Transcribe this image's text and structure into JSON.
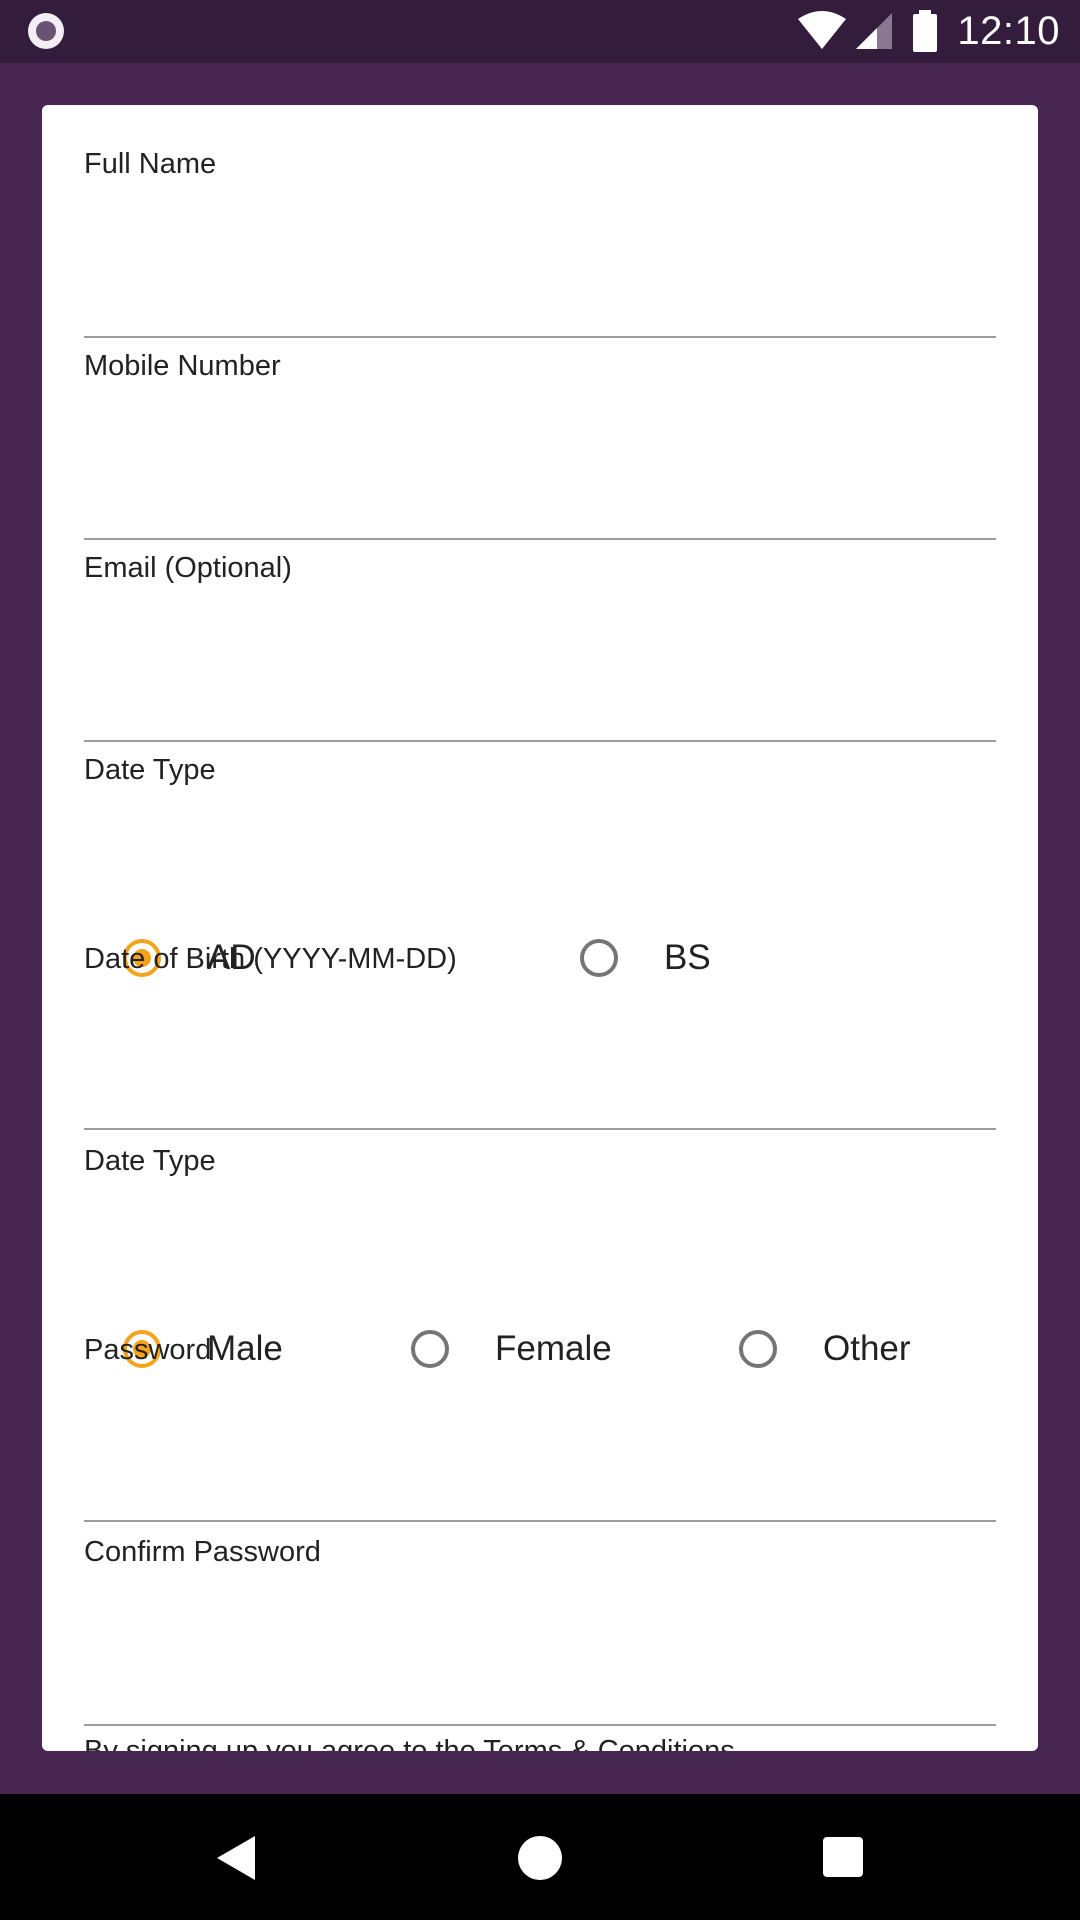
{
  "status_bar": {
    "time": "12:10",
    "icons": [
      "app-notification-icon",
      "wifi-icon",
      "cell-signal-icon",
      "battery-icon"
    ]
  },
  "form": {
    "full_name": {
      "label": "Full Name",
      "value": ""
    },
    "mobile_number": {
      "label": "Mobile Number",
      "value": ""
    },
    "email": {
      "label": "Email (Optional)",
      "value": ""
    },
    "date_type": {
      "label": "Date Type",
      "options": [
        {
          "label": "AD",
          "checked": true
        },
        {
          "label": "BS",
          "checked": false
        }
      ]
    },
    "date_of_birth": {
      "label": "Date of Birth (YYYY-MM-DD)",
      "value": ""
    },
    "gender": {
      "label": "Date Type",
      "options": [
        {
          "label": "Male",
          "checked": true
        },
        {
          "label": "Female",
          "checked": false
        },
        {
          "label": "Other",
          "checked": false
        }
      ]
    },
    "password": {
      "label": "Password",
      "value": ""
    },
    "confirm_password": {
      "label": "Confirm Password",
      "value": ""
    },
    "terms": "By signing up you agree to the Terms & Conditions"
  },
  "colors": {
    "background": "#472751",
    "status_bar": "#341c3d",
    "accent": "#f5a31a",
    "card": "#ffffff"
  },
  "nav_bar": {
    "icons": [
      "back-icon",
      "home-icon",
      "recents-icon"
    ]
  }
}
